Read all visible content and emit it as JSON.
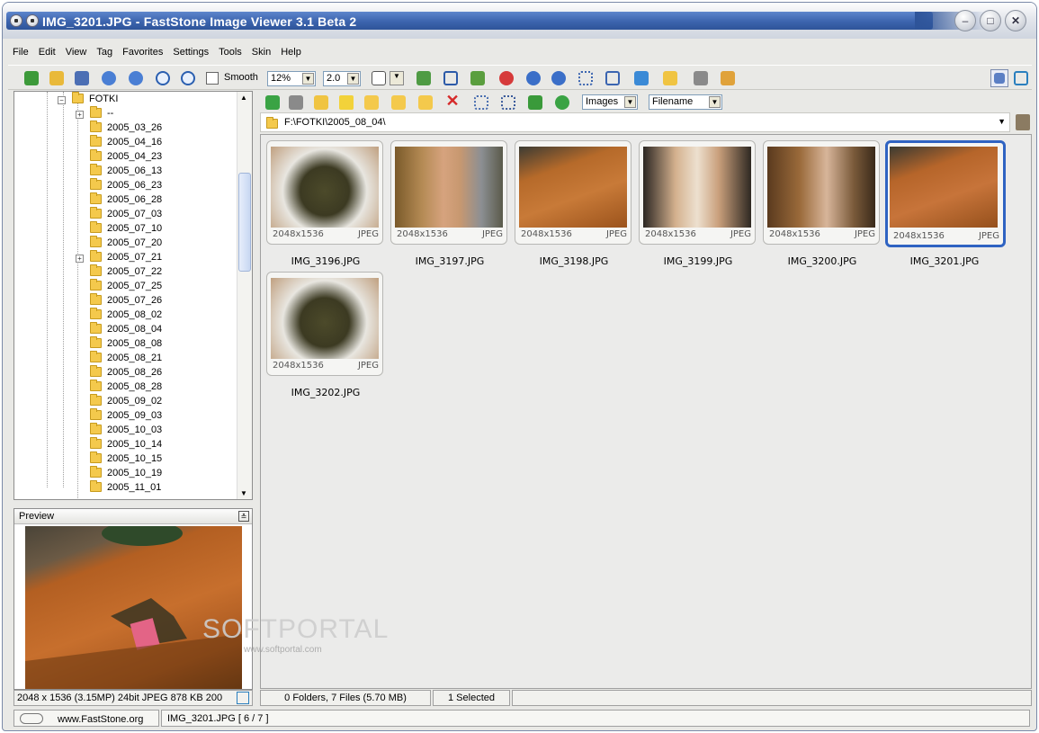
{
  "window": {
    "title": "IMG_3201.JPG  -  FastStone Image Viewer 3.1 Beta 2",
    "controls": [
      "minimize",
      "maximize",
      "close"
    ]
  },
  "menu": [
    "File",
    "Edit",
    "View",
    "Tag",
    "Favorites",
    "Settings",
    "Tools",
    "Skin",
    "Help"
  ],
  "toolbar": {
    "smooth_label": "Smooth",
    "smooth_checked": false,
    "zoom_value": "12%",
    "factor_value": "2.0"
  },
  "tree": {
    "root": "FOTKI",
    "items": [
      "--",
      "2005_03_26",
      "2005_04_16",
      "2005_04_23",
      "2005_06_13",
      "2005_06_23",
      "2005_06_28",
      "2005_07_03",
      "2005_07_10",
      "2005_07_20",
      "2005_07_21",
      "2005_07_22",
      "2005_07_25",
      "2005_07_26",
      "2005_08_02",
      "2005_08_04",
      "2005_08_08",
      "2005_08_21",
      "2005_08_26",
      "2005_08_28",
      "2005_09_02",
      "2005_09_03",
      "2005_10_03",
      "2005_10_14",
      "2005_10_15",
      "2005_10_19",
      "2005_11_01"
    ]
  },
  "preview": {
    "title": "Preview"
  },
  "browser": {
    "filter_value": "Images",
    "sort_value": "Filename",
    "path": "F:\\FOTKI\\2005_08_04\\"
  },
  "thumbnails": [
    {
      "name": "IMG_3196.JPG",
      "dims": "2048x1536",
      "format": "JPEG",
      "selected": false
    },
    {
      "name": "IMG_3197.JPG",
      "dims": "2048x1536",
      "format": "JPEG",
      "selected": false
    },
    {
      "name": "IMG_3198.JPG",
      "dims": "2048x1536",
      "format": "JPEG",
      "selected": false
    },
    {
      "name": "IMG_3199.JPG",
      "dims": "2048x1536",
      "format": "JPEG",
      "selected": false
    },
    {
      "name": "IMG_3200.JPG",
      "dims": "2048x1536",
      "format": "JPEG",
      "selected": false
    },
    {
      "name": "IMG_3201.JPG",
      "dims": "2048x1536",
      "format": "JPEG",
      "selected": true
    },
    {
      "name": "IMG_3202.JPG",
      "dims": "2048x1536",
      "format": "JPEG",
      "selected": false
    }
  ],
  "status": {
    "image_info": "2048 x 1536 (3.15MP)   24bit JPEG   878 KB   200",
    "folder_summary": "0 Folders, 7 Files (5.70 MB)",
    "selection": "1 Selected",
    "website": "www.FastStone.org",
    "current_file": "IMG_3201.JPG [ 6 / 7 ]"
  },
  "watermark": {
    "brand": "SOFTPORTAL",
    "url": "www.softportal.com"
  },
  "colors": {
    "title_bar": "#3c64ae",
    "selection_border": "#2f63c2",
    "panel_background": "#ebebea"
  }
}
